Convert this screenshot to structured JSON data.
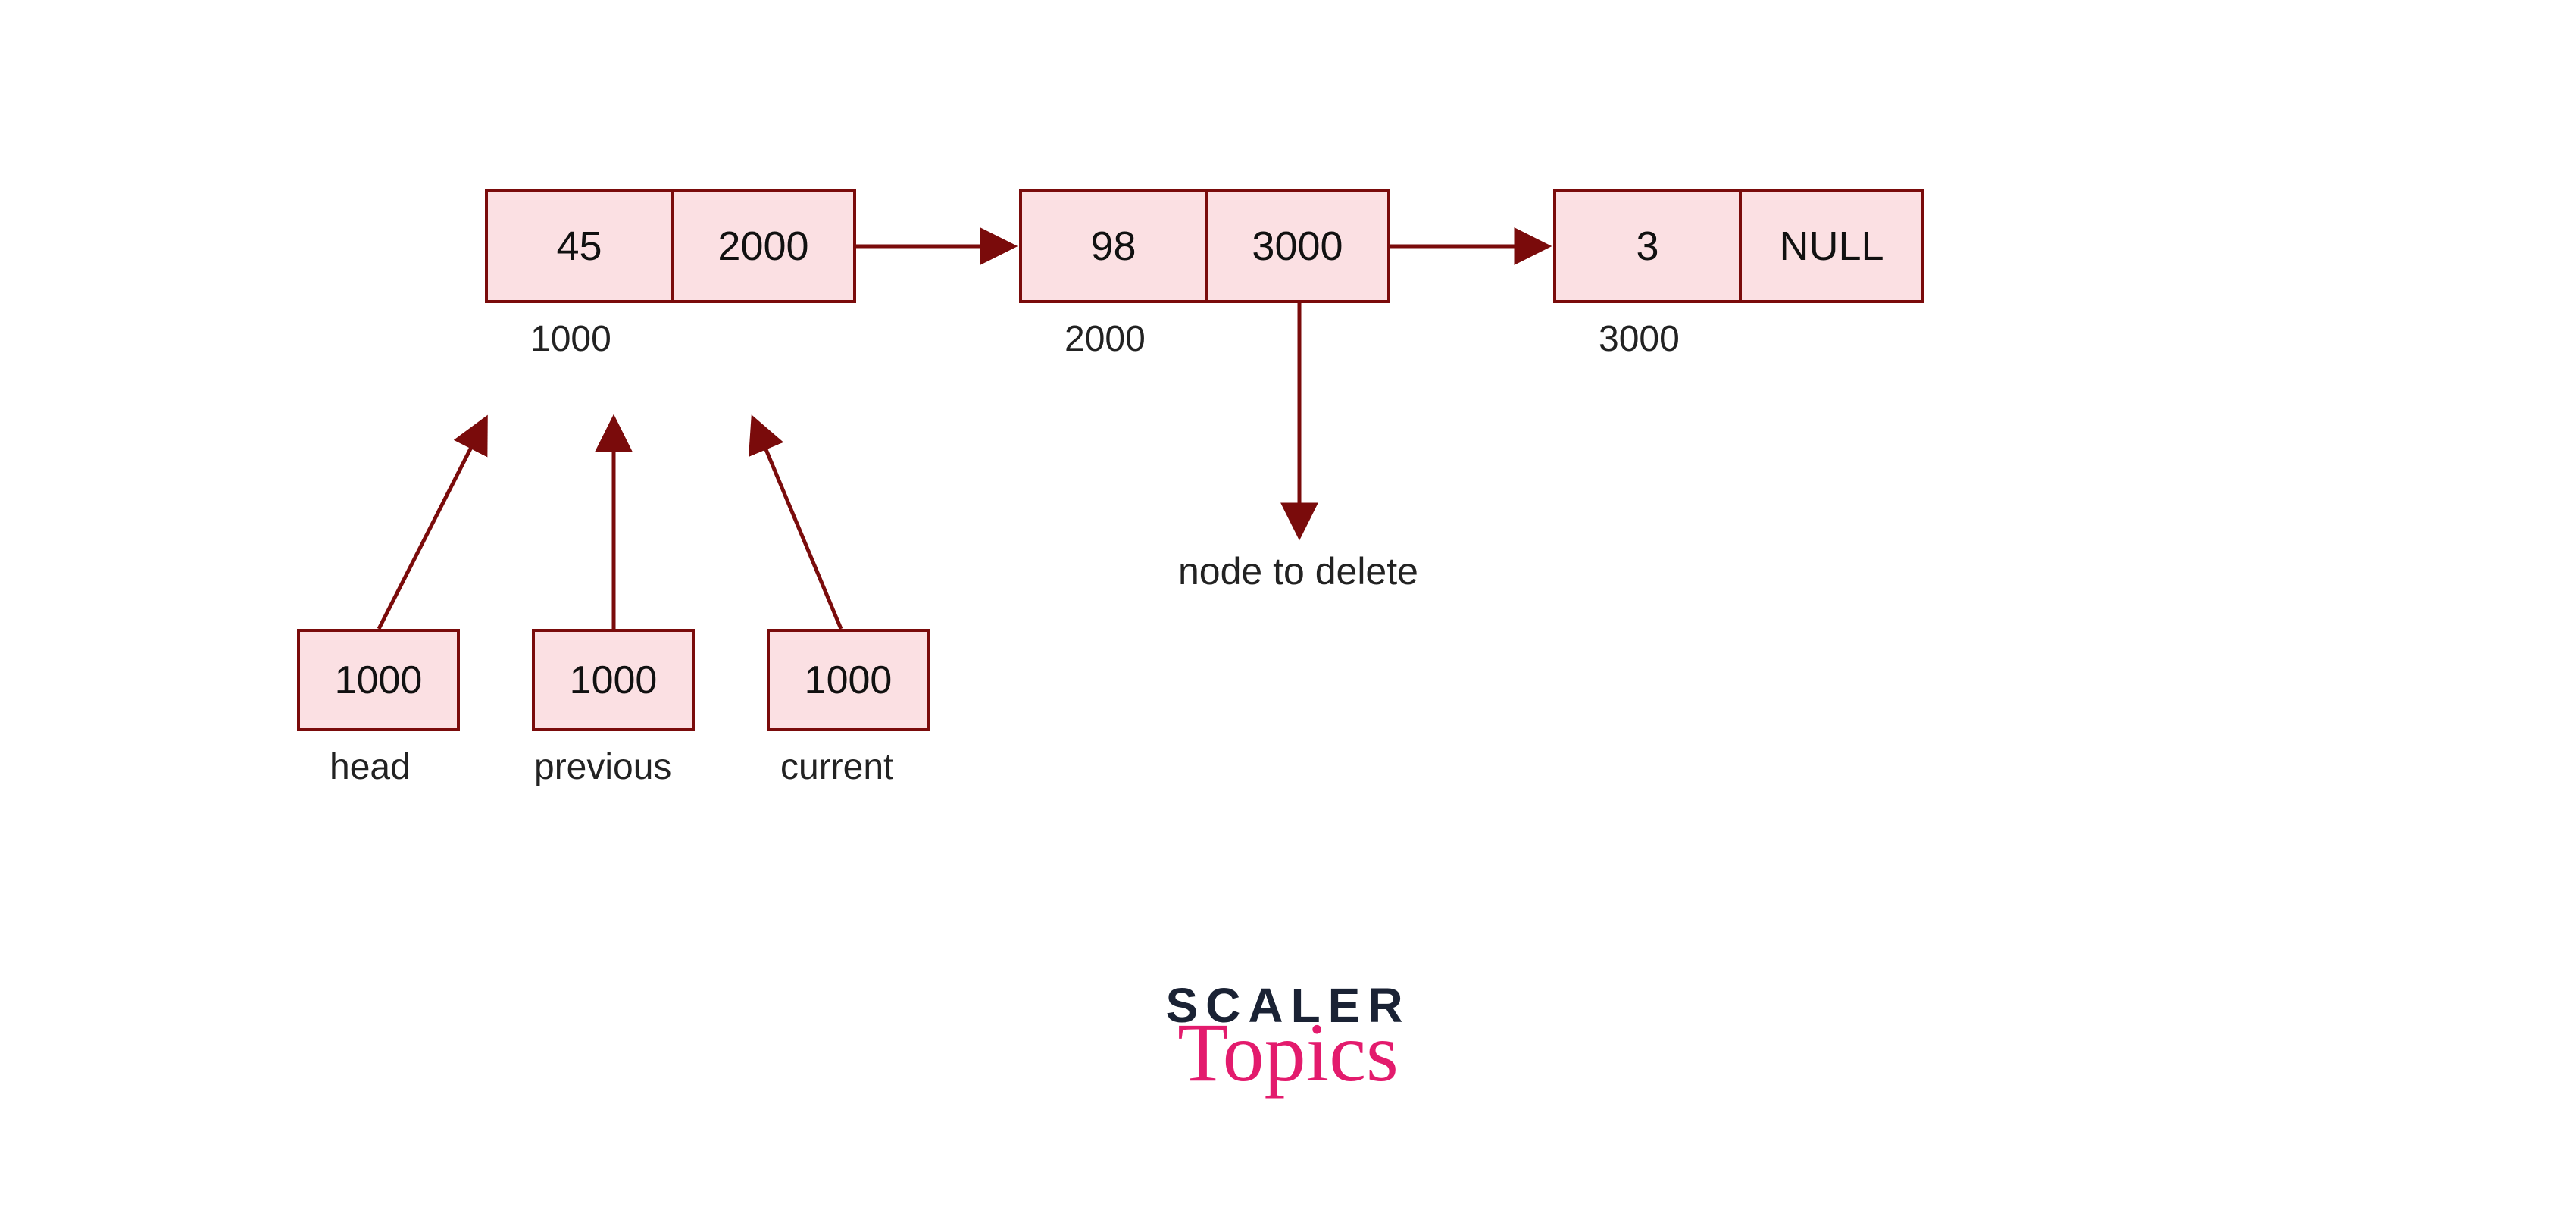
{
  "nodes": [
    {
      "data": "45",
      "next": "2000",
      "address": "1000"
    },
    {
      "data": "98",
      "next": "3000",
      "address": "2000"
    },
    {
      "data": "3",
      "next": "NULL",
      "address": "3000"
    }
  ],
  "pointers": [
    {
      "value": "1000",
      "label": "head"
    },
    {
      "value": "1000",
      "label": "previous"
    },
    {
      "value": "1000",
      "label": "current"
    }
  ],
  "annotation": "node to delete",
  "logo": {
    "line1": "SCALER",
    "line2": "Topics"
  },
  "colors": {
    "border": "#7a0b0b",
    "fill": "#fbe0e3",
    "accent": "#e31b6d",
    "dark": "#1a2234"
  }
}
